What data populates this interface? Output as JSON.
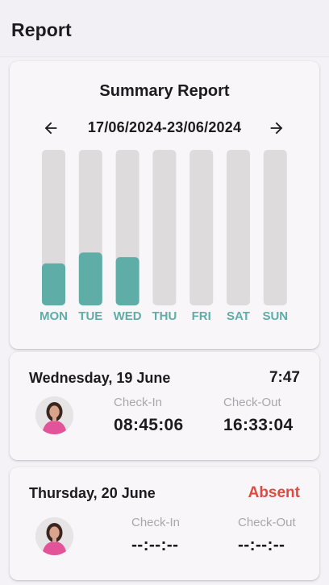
{
  "app_bar": {
    "title": "Report"
  },
  "summary": {
    "title": "Summary Report",
    "date_range": "17/06/2024-23/06/2024",
    "prev_icon": "arrow-left-icon",
    "next_icon": "arrow-right-icon"
  },
  "chart_data": {
    "type": "bar",
    "categories": [
      "MON",
      "TUE",
      "WED",
      "THU",
      "FRI",
      "SAT",
      "SUN"
    ],
    "values": [
      0.27,
      0.34,
      0.31,
      0,
      0,
      0,
      0
    ],
    "ylim": [
      0,
      1
    ],
    "bar_color": "#5fada7",
    "track_color": "#dedbdd",
    "label_color": "#5fada7"
  },
  "records": [
    {
      "date": "Wednesday, 19 June",
      "status": "7:47",
      "check_in_label": "Check-In",
      "check_in": "08:45:06",
      "check_out_label": "Check-Out",
      "check_out": "16:33:04"
    },
    {
      "date": "Thursday, 20 June",
      "status": "Absent",
      "status_color": "#e04a3f",
      "check_in_label": "Check-In",
      "check_in": "--:--:--",
      "check_out_label": "Check-Out",
      "check_out": "--:--:--"
    }
  ]
}
